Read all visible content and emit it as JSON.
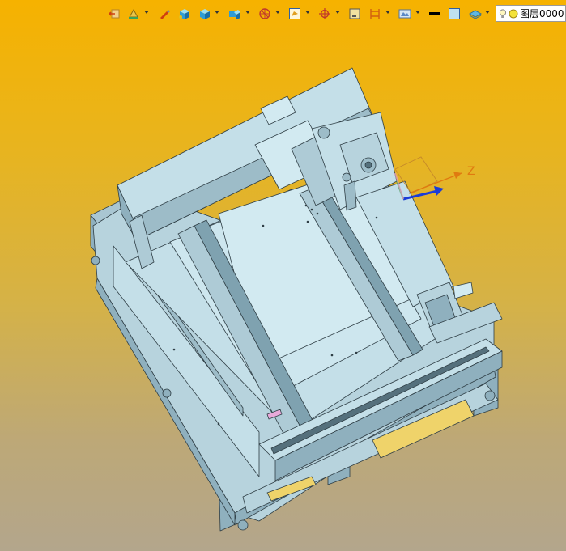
{
  "toolbar": {
    "items": [
      {
        "name": "undo-view-icon"
      },
      {
        "name": "paint-icon"
      },
      {
        "name": "pen-icon"
      },
      {
        "name": "solid-cube-icon"
      },
      {
        "name": "view-cube-icon"
      },
      {
        "name": "display-mode-icon"
      },
      {
        "name": "section-view-icon"
      },
      {
        "name": "fit-view-icon"
      },
      {
        "name": "snap-target-icon"
      },
      {
        "name": "frame-icon"
      },
      {
        "name": "dimension-icon"
      },
      {
        "name": "render-icon"
      },
      {
        "name": "line-color-icon"
      },
      {
        "name": "fill-color-icon"
      },
      {
        "name": "layer-manager-icon"
      }
    ],
    "layer": {
      "label": "图层0000",
      "bulb_icon": "lightbulb-icon",
      "state_icon": "sun-icon"
    }
  },
  "viewport": {
    "background_top": "#f6b200",
    "background_bottom": "#b3a68c",
    "model_color": "#c4dfe8",
    "triad": {
      "z_label": "Z",
      "z_color": "#e07a10",
      "x_color": "#1a3cd8"
    }
  }
}
